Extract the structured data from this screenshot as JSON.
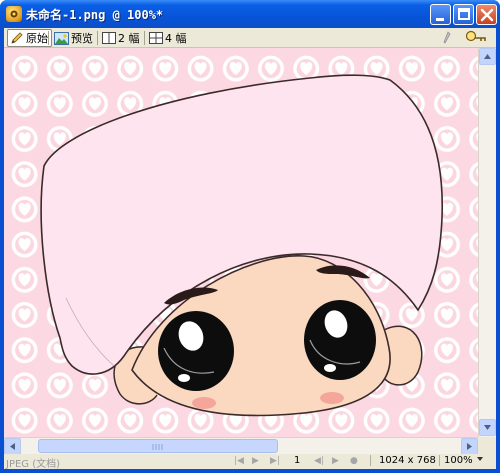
{
  "window": {
    "title": "未命名-1.png @ 100%*"
  },
  "toolbar": {
    "original_label": "原始",
    "preview_label": "预览",
    "two_up_label": "2 幅",
    "four_up_label": "4 幅"
  },
  "statusbar": {
    "format_text": "JPEG (文档)",
    "frame_number": "1",
    "dimensions": "1024 x 768",
    "zoom": "100%"
  },
  "colors": {
    "titlebar": "#0754d8",
    "canvas_bg": "#fbd8e2",
    "pattern_circle": "#ffffff",
    "pattern_heart": "#fbd0dc",
    "hat": "#fde4ee",
    "skin": "#fbd9c0",
    "blush": "#f4a69a"
  }
}
